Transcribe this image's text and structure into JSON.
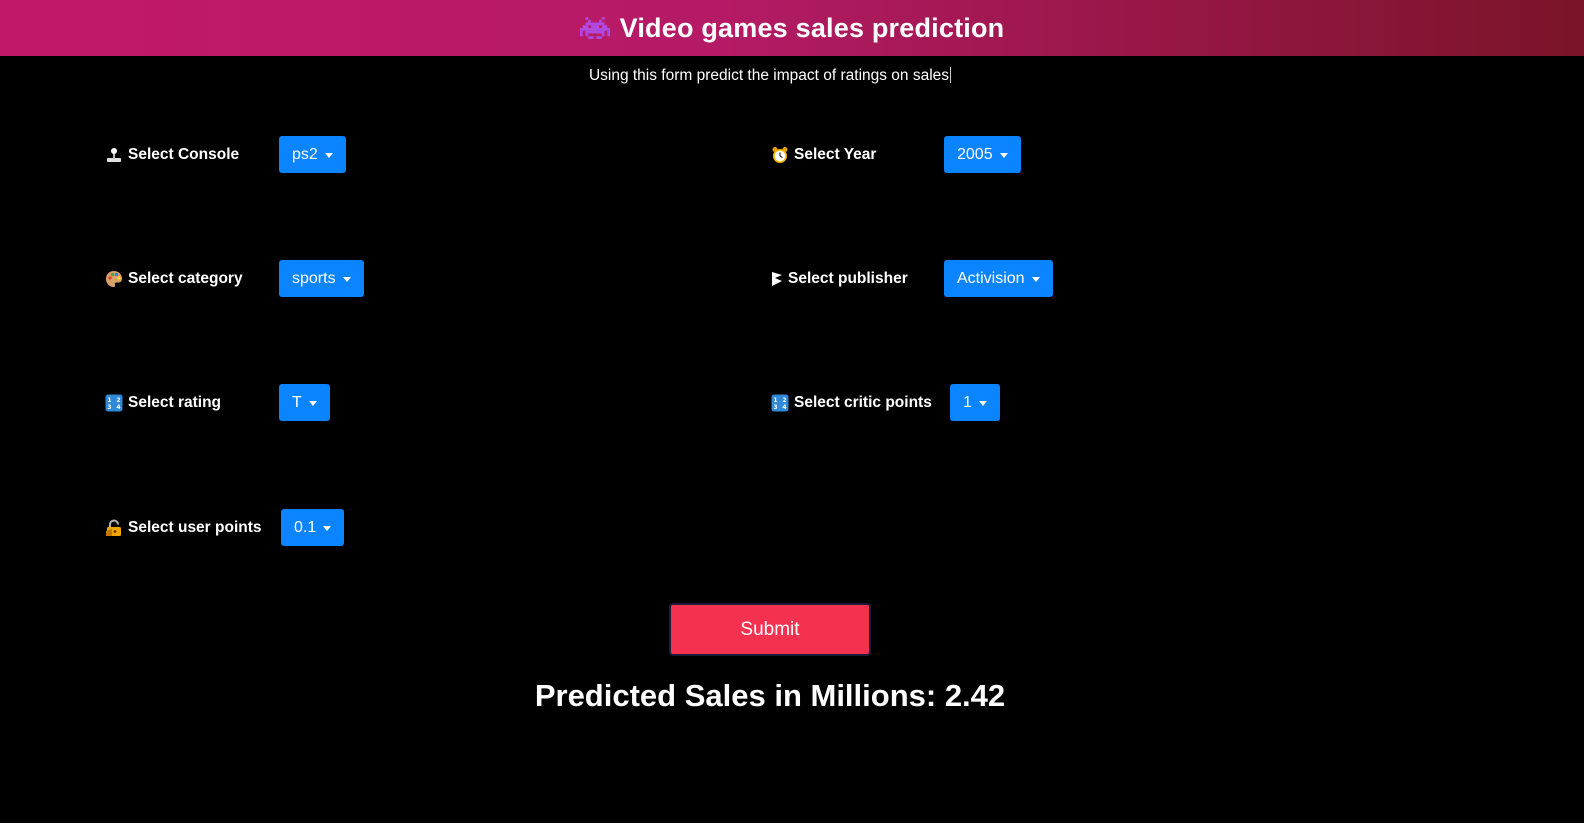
{
  "header": {
    "icon": "space-invader-icon",
    "title": "Video games sales prediction"
  },
  "subtitle": "Using this form predict the impact of ratings on sales",
  "fields": {
    "console": {
      "icon": "joystick-icon",
      "label": "Select Console",
      "value": "ps2"
    },
    "year": {
      "icon": "alarm-clock-icon",
      "label": "Select Year",
      "value": "2005"
    },
    "category": {
      "icon": "palette-icon",
      "label": "Select category",
      "value": "sports"
    },
    "publisher": {
      "icon": "flag-icon",
      "label": "Select publisher",
      "value": "Activision"
    },
    "rating": {
      "icon": "numbers-icon",
      "label": "Select rating",
      "value": "T"
    },
    "critic_points": {
      "icon": "numbers-icon",
      "label": "Select critic points",
      "value": "1"
    },
    "user_points": {
      "icon": "lock-icon",
      "label": "Select user points",
      "value": "0.1"
    }
  },
  "submit_label": "Submit",
  "result": "Predicted Sales in Millions: 2.42",
  "colors": {
    "header_start": "#c2186b",
    "header_end": "#7a1428",
    "dropdown": "#0a84ff",
    "submit": "#f4314f",
    "background": "#000000"
  }
}
